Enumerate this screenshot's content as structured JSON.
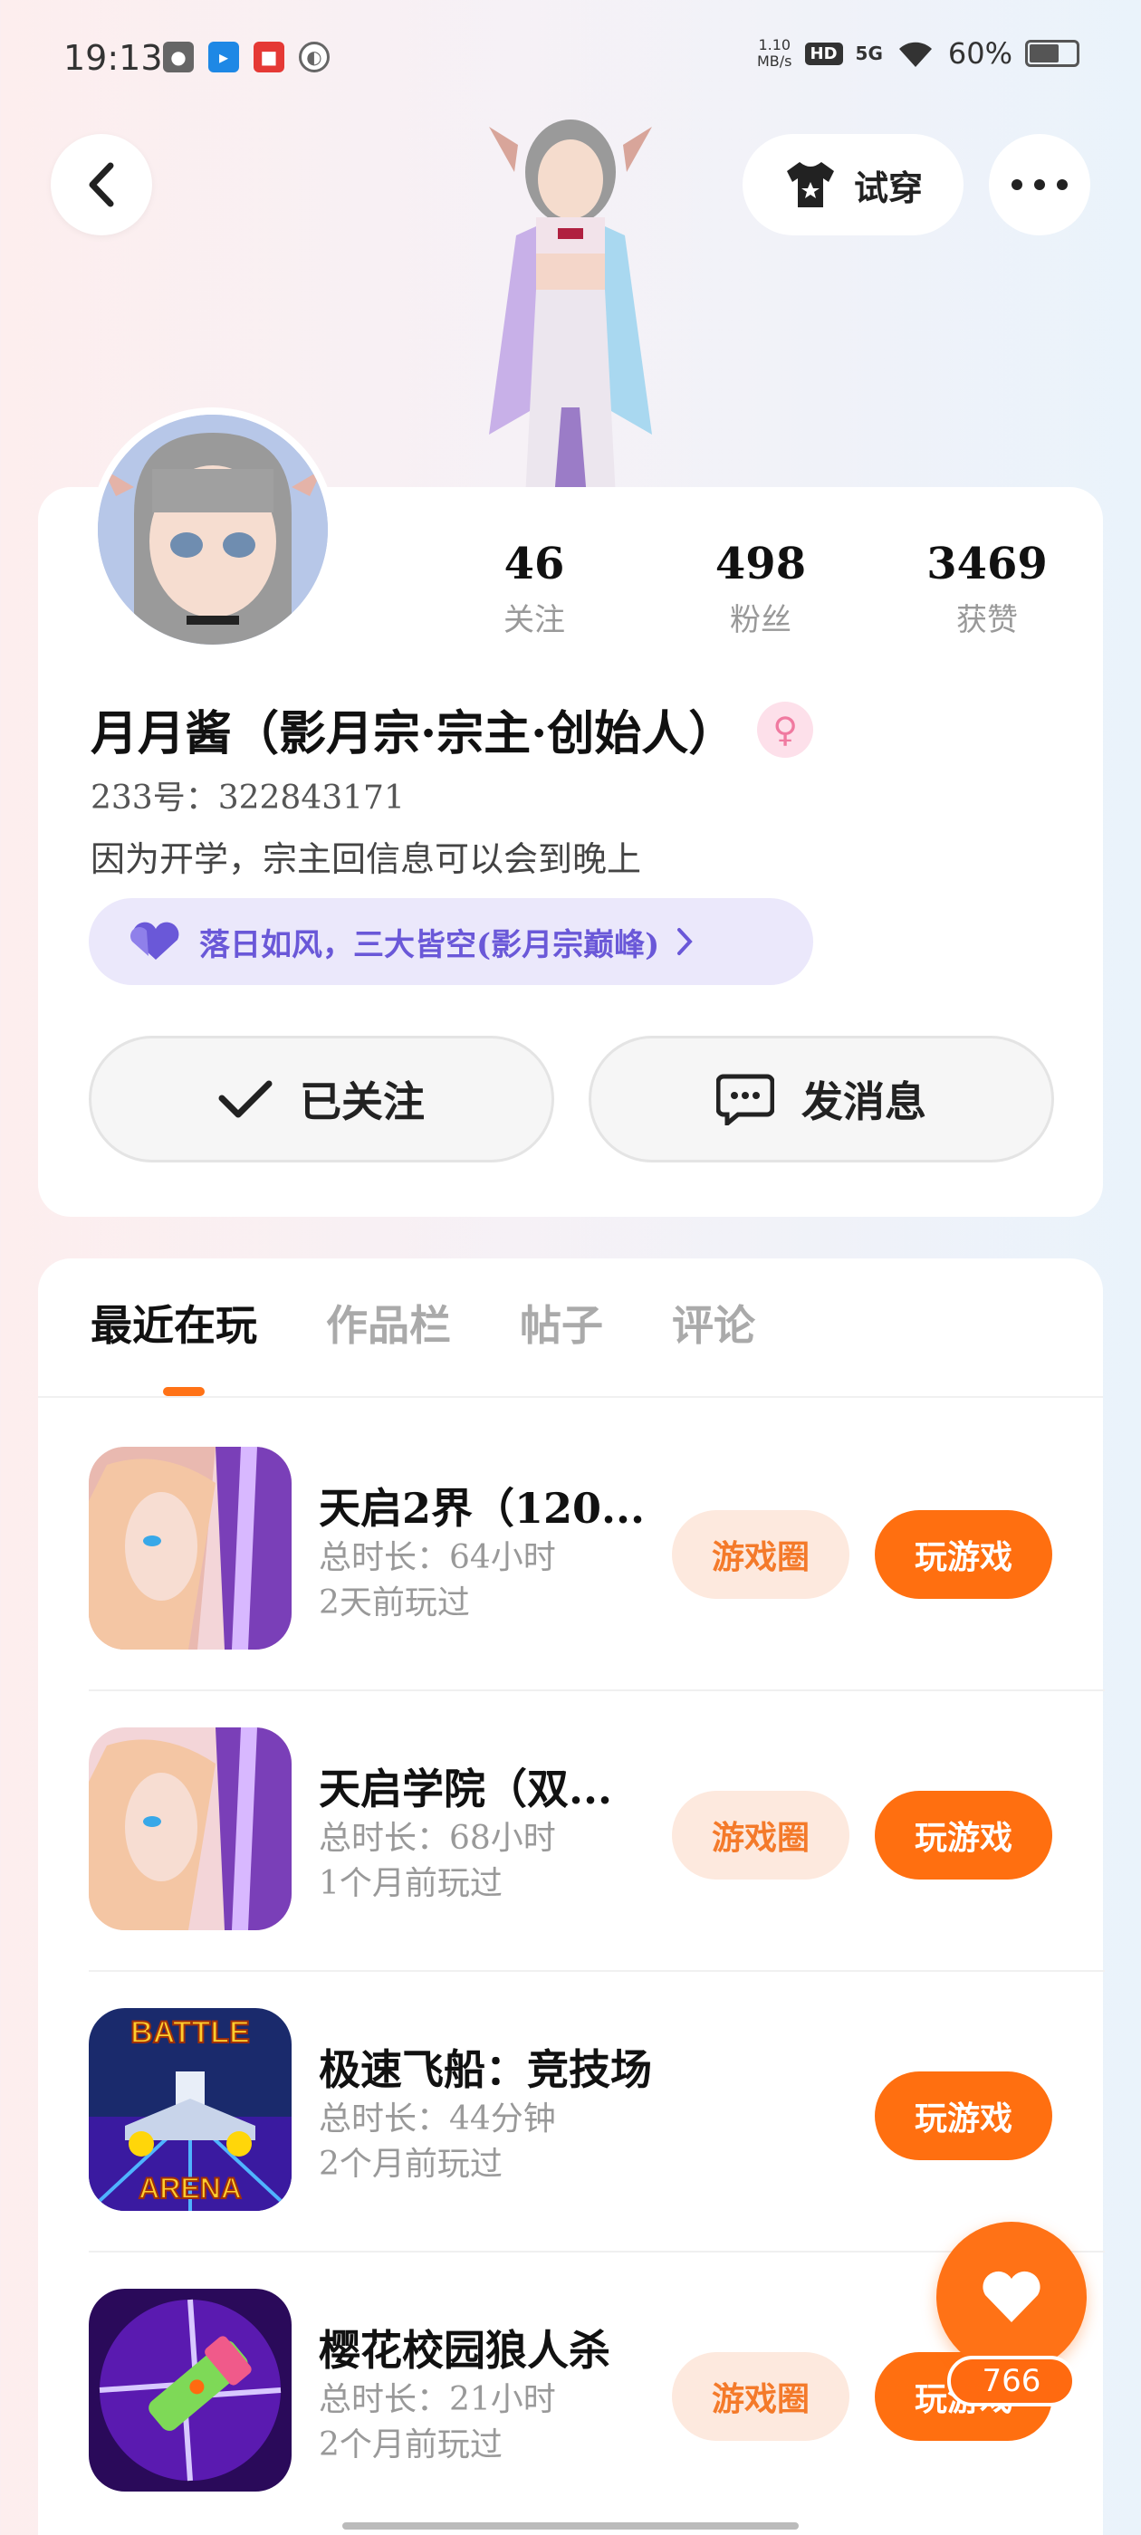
{
  "status_bar": {
    "time": "19:13",
    "net_speed": "1.10",
    "net_unit": "MB/s",
    "hd": "HD",
    "signal": "5G",
    "battery": "60%",
    "battery_level": 0.6,
    "icons": [
      "wechat-icon",
      "app-blue-icon",
      "app-red-icon",
      "app-circle-icon",
      "wifi-icon",
      "battery-icon"
    ]
  },
  "topbar": {
    "tryon_label": "试穿"
  },
  "profile": {
    "stats": [
      {
        "value": "46",
        "label": "关注"
      },
      {
        "value": "498",
        "label": "粉丝"
      },
      {
        "value": "3469",
        "label": "获赞"
      }
    ],
    "name": "月月酱（影月宗·宗主·创始人）",
    "uid": "233号：322843171",
    "bio": "因为开学，宗主回信息可以会到晚上",
    "guild": "落日如风，三大皆空(影月宗巅峰)",
    "follow_label": "已关注",
    "message_label": "发消息"
  },
  "tabs": [
    {
      "label": "最近在玩",
      "active": true
    },
    {
      "label": "作品栏",
      "active": false
    },
    {
      "label": "帖子",
      "active": false
    },
    {
      "label": "评论",
      "active": false
    }
  ],
  "games": [
    {
      "title": "天启2界（120...",
      "duration": "总时长：64小时",
      "last_played": "2天前玩过",
      "circle_label": "游戏圈",
      "play_label": "玩游戏"
    },
    {
      "title": "天启学院（双...",
      "duration": "总时长：68小时",
      "last_played": "1个月前玩过",
      "circle_label": "游戏圈",
      "play_label": "玩游戏"
    },
    {
      "title": "极速飞船：竞技场",
      "duration": "总时长：44分钟",
      "last_played": "2个月前玩过",
      "play_label": "玩游戏",
      "icon_text_top": "BATTLE",
      "icon_text_bottom": "ARENA"
    },
    {
      "title": "樱花校园狼人杀",
      "duration": "总时长：21小时",
      "last_played": "2个月前玩过",
      "circle_label": "游戏圈",
      "play_label": "玩游戏"
    }
  ],
  "like": {
    "count": "766"
  },
  "colors": {
    "accent": "#ff7216",
    "guild_bg": "#ebe8fb",
    "guild_text": "#6a58d8",
    "circle_bg": "#fde9de"
  }
}
